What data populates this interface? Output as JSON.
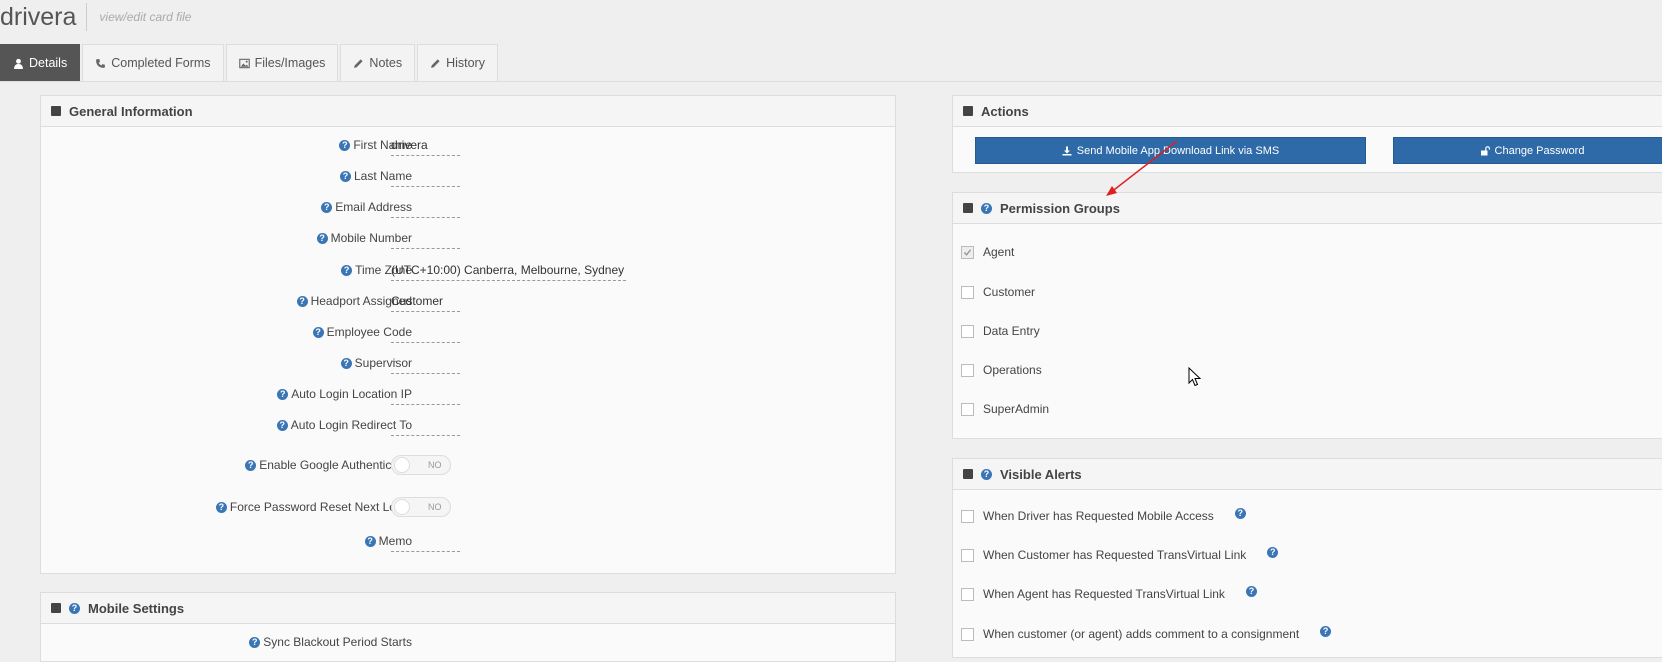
{
  "header": {
    "title": "drivera",
    "subtitle": "view/edit card file"
  },
  "tabs": [
    {
      "label": "Details",
      "icon": "user-icon",
      "active": true
    },
    {
      "label": "Completed Forms",
      "icon": "phone-icon"
    },
    {
      "label": "Files/Images",
      "icon": "image-icon"
    },
    {
      "label": "Notes",
      "icon": "pencil-icon"
    },
    {
      "label": "History",
      "icon": "pencil-icon"
    }
  ],
  "general": {
    "title": "General Information",
    "fields": [
      {
        "label": "First Name",
        "value": "drivera"
      },
      {
        "label": "Last Name",
        "value": ""
      },
      {
        "label": "Email Address",
        "value": ""
      },
      {
        "label": "Mobile Number",
        "value": ""
      },
      {
        "label": "Time Zone",
        "value": "(UTC+10:00) Canberra, Melbourne, Sydney"
      },
      {
        "label": "Headport Assigned",
        "value": "Customer"
      },
      {
        "label": "Employee Code",
        "value": ""
      },
      {
        "label": "Supervisor",
        "value": "--"
      },
      {
        "label": "Auto Login Location IP",
        "value": ""
      },
      {
        "label": "Auto Login Redirect To",
        "value": ""
      }
    ],
    "google_auth": {
      "label": "Enable Google Authenticator",
      "value": "NO"
    },
    "force_reset": {
      "label": "Force Password Reset Next Login",
      "value": "NO"
    },
    "memo": {
      "label": "Memo",
      "value": ""
    }
  },
  "mobile": {
    "title": "Mobile Settings",
    "sync_label": "Sync Blackout Period Starts"
  },
  "actions": {
    "title": "Actions",
    "sms_button": "Send Mobile App Download Link via SMS",
    "password_button": "Change Password"
  },
  "permissions": {
    "title": "Permission Groups",
    "items": [
      {
        "label": "Agent",
        "checked": true
      },
      {
        "label": "Customer",
        "checked": false
      },
      {
        "label": "Data Entry",
        "checked": false
      },
      {
        "label": "Operations",
        "checked": false
      },
      {
        "label": "SuperAdmin",
        "checked": false
      }
    ]
  },
  "alerts": {
    "title": "Visible Alerts",
    "items": [
      {
        "label": "When Driver has Requested Mobile Access"
      },
      {
        "label": "When Customer has Requested TransVirtual Link"
      },
      {
        "label": "When Agent has Requested TransVirtual Link"
      },
      {
        "label": "When customer (or agent) adds comment to a consignment"
      }
    ]
  },
  "colors": {
    "accent": "#2e6aa8",
    "help": "#3a76b5",
    "tab_active": "#555555",
    "arrow": "#e02020"
  }
}
